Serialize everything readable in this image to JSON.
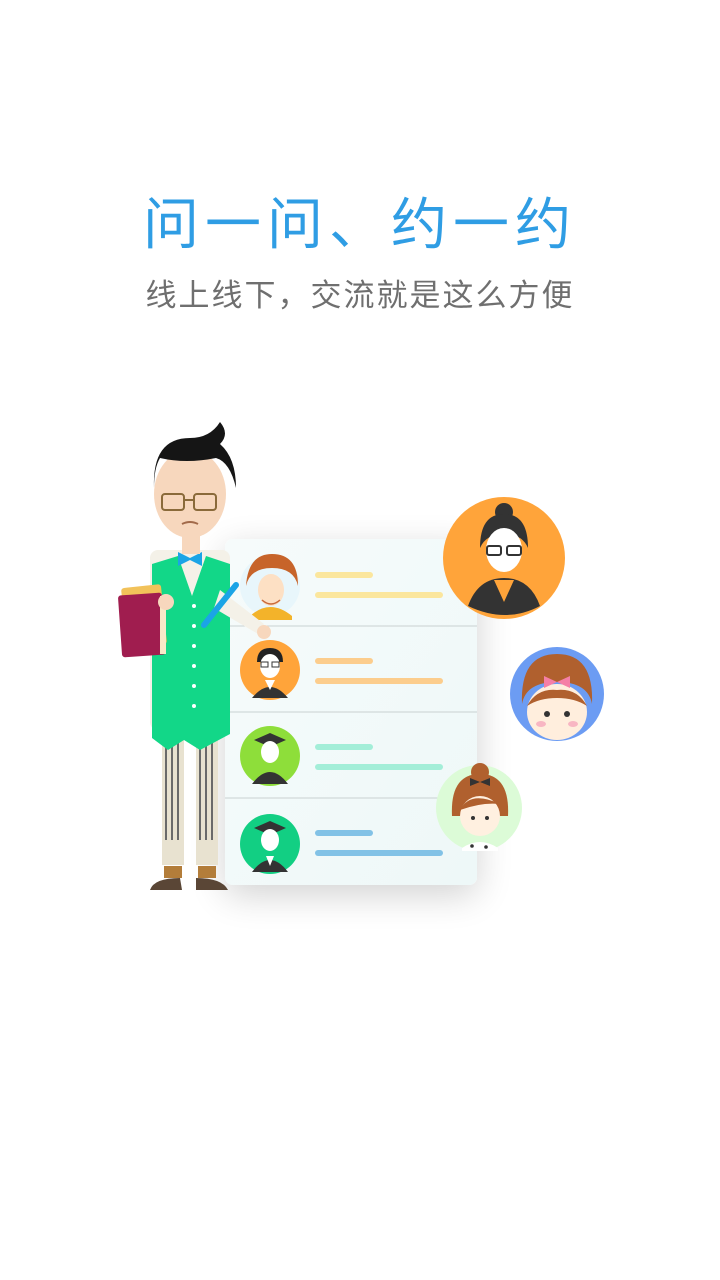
{
  "onboarding": {
    "title": "问一问、约一约",
    "subtitle": "线上线下，交流就是这么方便"
  },
  "colors": {
    "title": "#2f9de4",
    "subtitle": "#6f6f6f",
    "card_background": "#f1f9fa",
    "avatar_orange": "#ffa43a",
    "avatar_blue": "#6c9cf3",
    "avatar_green": "#8ede3a",
    "avatar_teal": "#12cf83",
    "avatar_mint": "#dcfbd7",
    "bar_yellow": "#fbe69d",
    "bar_orange": "#fccd8d",
    "bar_teal": "#a3eed8",
    "bar_blue": "#82c2e6",
    "vest_green": "#12d788"
  },
  "icons": {
    "teacher": "teacher-illustration-icon",
    "list_avatars": [
      "girl-avatar-icon",
      "glasses-man-avatar-icon",
      "graduate-avatar-icon",
      "graduate-man-avatar-icon"
    ],
    "floating_avatars": [
      "woman-teacher-avatar-icon",
      "bow-girl-avatar-icon",
      "bun-girl-avatar-icon"
    ]
  }
}
